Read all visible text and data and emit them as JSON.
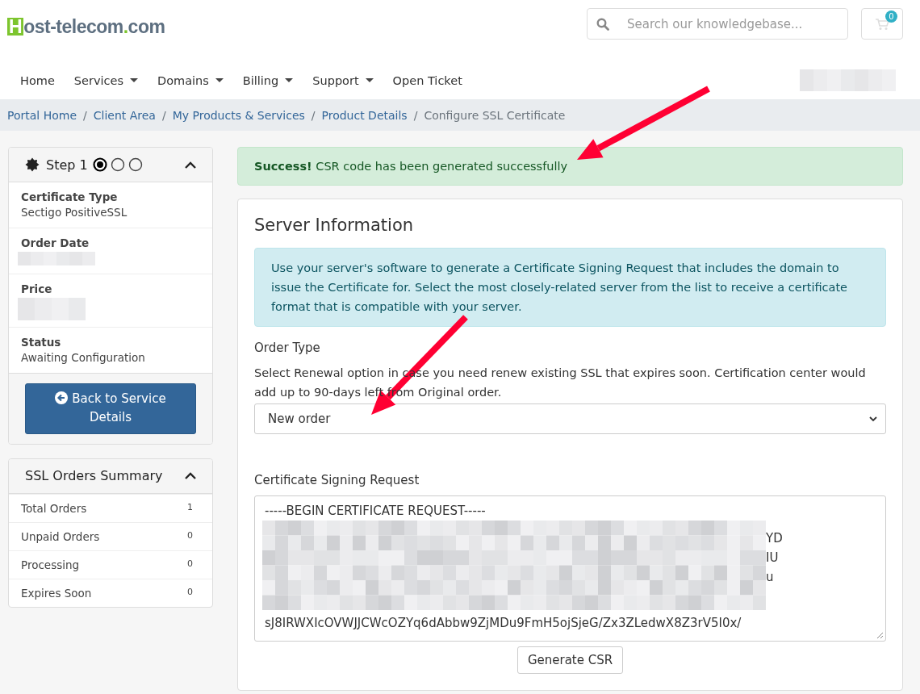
{
  "header": {
    "logo": {
      "initial": "H",
      "name": "ost-telecom",
      "dot": ".",
      "tld": "com"
    },
    "search": {
      "placeholder": "Search our knowledgebase..."
    },
    "cart_count": "0"
  },
  "nav": [
    {
      "label": "Home",
      "dropdown": false
    },
    {
      "label": "Services",
      "dropdown": true
    },
    {
      "label": "Domains",
      "dropdown": true
    },
    {
      "label": "Billing",
      "dropdown": true
    },
    {
      "label": "Support",
      "dropdown": true
    },
    {
      "label": "Open Ticket",
      "dropdown": false
    }
  ],
  "breadcrumb": [
    {
      "label": "Portal Home",
      "current": false
    },
    {
      "separator": "/",
      "label": "Client Area",
      "current": false
    },
    {
      "separator": "/",
      "label": "My Products & Services",
      "current": false
    },
    {
      "separator": "/",
      "label": "Product Details",
      "current": false
    },
    {
      "separator": "/",
      "label": "Configure SSL Certificate",
      "current": true
    }
  ],
  "step_panel": {
    "title": "Step 1",
    "expanded": true,
    "steps": [
      {
        "selected": true
      },
      {
        "selected": false
      },
      {
        "selected": false
      }
    ],
    "fields": [
      {
        "label": "Certificate Type",
        "value": "Sectigo PositiveSSL"
      },
      {
        "label": "Order Date",
        "redacted": true
      },
      {
        "label": "Price",
        "redacted": true
      },
      {
        "label": "Status",
        "value": "Awaiting Configuration"
      }
    ],
    "button": "Back to Service Details"
  },
  "summary_panel": {
    "title": "SSL Orders Summary",
    "expanded": true,
    "rows": [
      {
        "label": "Total Orders",
        "count": "1"
      },
      {
        "label": "Unpaid Orders",
        "count": "0"
      },
      {
        "label": "Processing",
        "count": "0"
      },
      {
        "label": "Expires Soon",
        "count": "0"
      }
    ]
  },
  "alert": {
    "text": "**Success!** CSR code has been generated successfully"
  },
  "server_info": {
    "title": "Server Information",
    "info": "Use your server's software to generate a Certificate Signing Request that includes the domain to issue the Certificate for. Select the most closely-related server from the list to receive a certificate format that is compatible with your server.",
    "order_type": {
      "label": "Order Type",
      "help": "Select Renewal option in case you need renew existing SSL that expires soon. Certification center would add up to 90-days left from Original order.",
      "value": "New order"
    },
    "csr": {
      "label": "Certificate Signing Request",
      "first_line": "-----BEGIN CERTIFICATE REQUEST-----",
      "fragments": [
        "YD",
        "IU",
        "u"
      ],
      "last_line": "sJ8IRWXIcOVWJJCWcOZYq6dAbbw9ZjMDu9FmH5ojSjeG/Zx3ZLedwX8Z3rV5I0x/"
    },
    "button": "Generate CSR"
  }
}
